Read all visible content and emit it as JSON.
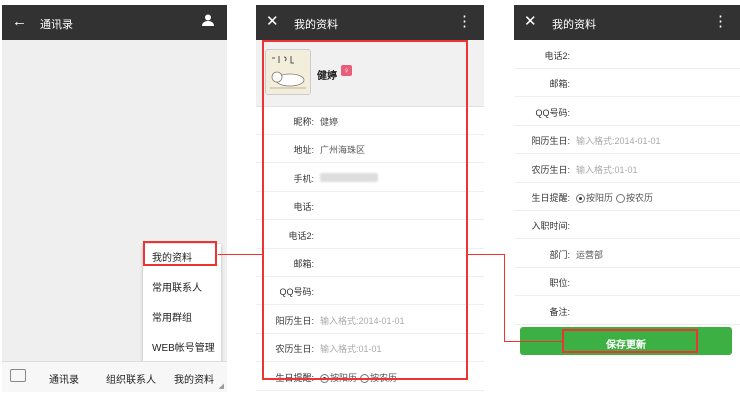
{
  "phone1": {
    "title": "通讯录",
    "menu": [
      "我的资料",
      "常用联系人",
      "常用群组",
      "WEB帐号管理"
    ],
    "tabs": [
      "通讯录",
      "组织联系人",
      "我的资料"
    ]
  },
  "phone2": {
    "title": "我的资料",
    "name": "健婷",
    "gender": "♀",
    "rows": [
      {
        "label": "昵称:",
        "value": "健婷",
        "type": "text"
      },
      {
        "label": "地址:",
        "value": "广州海珠区",
        "type": "text"
      },
      {
        "label": "手机:",
        "value": "",
        "type": "blurred"
      },
      {
        "label": "电话:",
        "value": "",
        "type": "text"
      },
      {
        "label": "电话2:",
        "value": "",
        "type": "text"
      },
      {
        "label": "邮箱:",
        "value": "",
        "type": "text"
      },
      {
        "label": "QQ号码:",
        "value": "",
        "type": "text"
      },
      {
        "label": "阳历生日:",
        "value": "输入格式:2014-01-01",
        "type": "placeholder"
      },
      {
        "label": "农历生日:",
        "value": "输入格式:01-01",
        "type": "placeholder"
      },
      {
        "label": "生日提醒:",
        "value": "",
        "type": "radio"
      }
    ]
  },
  "phone3": {
    "title": "我的资料",
    "rows": [
      {
        "label": "电话2:",
        "value": "",
        "type": "text"
      },
      {
        "label": "邮箱:",
        "value": "",
        "type": "text"
      },
      {
        "label": "QQ号码:",
        "value": "",
        "type": "text"
      },
      {
        "label": "阳历生日:",
        "value": "输入格式:2014-01-01",
        "type": "placeholder"
      },
      {
        "label": "农历生日:",
        "value": "输入格式:01-01",
        "type": "placeholder"
      },
      {
        "label": "生日提醒:",
        "value": "",
        "type": "radio"
      },
      {
        "label": "入职时间:",
        "value": "",
        "type": "text"
      },
      {
        "label": "部门:",
        "value": "运营部",
        "type": "text"
      },
      {
        "label": "职位:",
        "value": "",
        "type": "text"
      },
      {
        "label": "备注:",
        "value": "",
        "type": "text"
      }
    ],
    "save_label": "保存更新"
  },
  "radio_options": {
    "solar": "按阳历",
    "lunar": "按农历"
  },
  "colors": {
    "appbar": "#323232",
    "highlight": "#e33333",
    "save": "#3cb043"
  }
}
